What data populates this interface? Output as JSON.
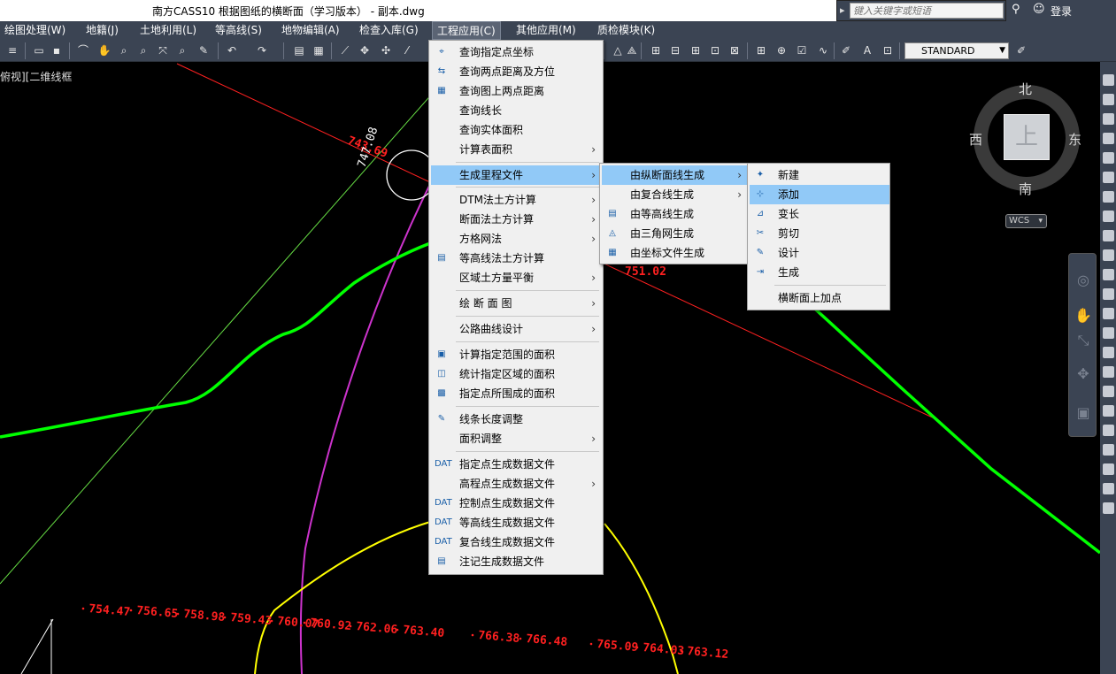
{
  "titlebar": {
    "title": "南方CASS10    根据图纸的横断面（学习版本） - 副本.dwg",
    "search_placeholder": "键入关键字或短语",
    "login": "登录"
  },
  "menubar": {
    "items": [
      "绘图处理(W)",
      "地籍(J)",
      "土地利用(L)",
      "等高线(S)",
      "地物编辑(A)",
      "检查入库(G)",
      "工程应用(C)",
      "其他应用(M)",
      "质检模块(K)"
    ]
  },
  "toolbar": {
    "text_style": "STANDARD"
  },
  "viewport": {
    "label": "俯视][二维线框"
  },
  "compass": {
    "north": "北",
    "south": "南",
    "east": "东",
    "west": "西",
    "top": "上",
    "wcs": "WCS"
  },
  "menu_main": {
    "items": [
      {
        "label": "查询指定点坐标",
        "icon": "query-point-icon",
        "submenu": false
      },
      {
        "label": "查询两点距离及方位",
        "icon": "distance-icon",
        "submenu": false
      },
      {
        "label": "查询图上两点距离",
        "icon": "map-distance-icon",
        "submenu": false
      },
      {
        "label": "查询线长",
        "icon": "",
        "submenu": false
      },
      {
        "label": "查询实体面积",
        "icon": "",
        "submenu": false
      },
      {
        "label": "计算表面积",
        "icon": "",
        "submenu": true
      },
      {
        "label": "生成里程文件",
        "icon": "",
        "submenu": true
      },
      {
        "label": "DTM法土方计算",
        "icon": "",
        "submenu": true
      },
      {
        "label": "断面法土方计算",
        "icon": "",
        "submenu": true
      },
      {
        "label": "方格网法",
        "icon": "",
        "submenu": true
      },
      {
        "label": "等高线法土方计算",
        "icon": "contour-volume-icon",
        "submenu": false
      },
      {
        "label": "区域土方量平衡",
        "icon": "",
        "submenu": true
      },
      {
        "label": "绘 断 面 图",
        "icon": "",
        "submenu": true
      },
      {
        "label": "公路曲线设计",
        "icon": "",
        "submenu": true
      },
      {
        "label": "计算指定范围的面积",
        "icon": "range-area-icon",
        "submenu": false
      },
      {
        "label": "统计指定区域的面积",
        "icon": "region-area-icon",
        "submenu": false
      },
      {
        "label": "指定点所围成的面积",
        "icon": "point-area-icon",
        "submenu": false
      },
      {
        "label": "线条长度调整",
        "icon": "line-adjust-icon",
        "submenu": false
      },
      {
        "label": "面积调整",
        "icon": "",
        "submenu": true
      },
      {
        "label": "指定点生成数据文件",
        "icon": "dat-icon",
        "submenu": false
      },
      {
        "label": "高程点生成数据文件",
        "icon": "",
        "submenu": true
      },
      {
        "label": "控制点生成数据文件",
        "icon": "dat-icon",
        "submenu": false
      },
      {
        "label": "等高线生成数据文件",
        "icon": "dat-icon",
        "submenu": false
      },
      {
        "label": "复合线生成数据文件",
        "icon": "dat-icon",
        "submenu": false
      },
      {
        "label": "注记生成数据文件",
        "icon": "annotation-icon",
        "submenu": false
      }
    ]
  },
  "menu_mileage": {
    "items": [
      {
        "label": "由纵断面线生成",
        "submenu": true
      },
      {
        "label": "由复合线生成",
        "submenu": true
      },
      {
        "label": "由等高线生成",
        "submenu": false
      },
      {
        "label": "由三角网生成",
        "submenu": false
      },
      {
        "label": "由坐标文件生成",
        "submenu": false
      }
    ]
  },
  "menu_profile": {
    "items": [
      {
        "label": "新建"
      },
      {
        "label": "添加"
      },
      {
        "label": "变长"
      },
      {
        "label": "剪切"
      },
      {
        "label": "设计"
      },
      {
        "label": "生成"
      },
      {
        "label": "横断面上加点"
      }
    ]
  },
  "drawing": {
    "labels": [
      "743.69",
      "747.08",
      "751.02",
      "754.47",
      "756.65",
      "758.98",
      "759.43",
      "760.07",
      "760.92",
      "762.06",
      "763.40",
      "766.38",
      "766.48",
      "765.09",
      "764.03",
      "763.12"
    ]
  },
  "colors": {
    "green": "#00ff00",
    "red_line": "#ff2020",
    "magenta": "#cc33cc",
    "yellow": "#ffff00",
    "light_green": "#66dd44",
    "highlight": "#91c9f7"
  }
}
